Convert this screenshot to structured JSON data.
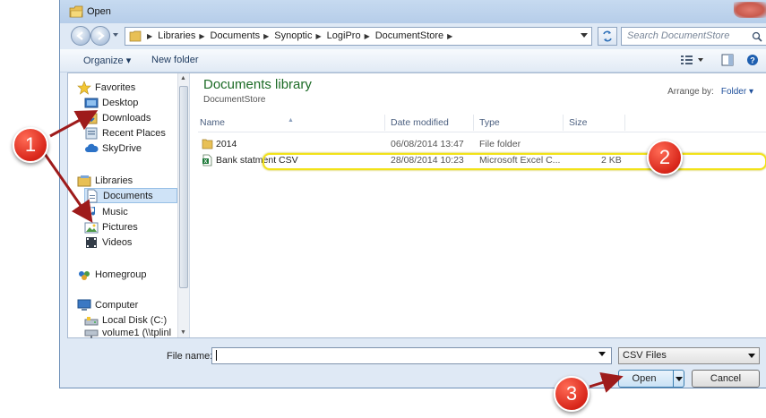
{
  "window": {
    "title": "Open",
    "title_icon": "folder-open-icon",
    "close_icon": "close-icon"
  },
  "address": {
    "crumbs": [
      "Libraries",
      "Documents",
      "Synoptic",
      "LogiPro",
      "DocumentStore"
    ],
    "search_placeholder": "Search DocumentStore"
  },
  "toolbar": {
    "organize_label": "Organize ▾",
    "new_folder_label": "New folder"
  },
  "nav": {
    "favorites": "Favorites",
    "desktop": "Desktop",
    "downloads": "Downloads",
    "recent": "Recent Places",
    "skydrive": "SkyDrive",
    "libraries": "Libraries",
    "documents": "Documents",
    "music": "Music",
    "pictures": "Pictures",
    "videos": "Videos",
    "homegroup": "Homegroup",
    "computer": "Computer",
    "localdisk": "Local Disk (C:)",
    "volume": "volume1 (\\\\tplinl"
  },
  "library": {
    "title": "Documents library",
    "subtitle": "DocumentStore",
    "arrange_label": "Arrange by:",
    "arrange_value": "Folder ▾"
  },
  "columns": {
    "name": "Name",
    "date": "Date modified",
    "type": "Type",
    "size": "Size"
  },
  "files": [
    {
      "name": "2014",
      "date": "06/08/2014 13:47",
      "type": "File folder",
      "size": ""
    },
    {
      "name": "Bank statment CSV",
      "date": "28/08/2014 10:23",
      "type": "Microsoft Excel C...",
      "size": "2 KB"
    }
  ],
  "footer": {
    "filename_label": "File name:",
    "filename_value": "",
    "filter": "CSV Files",
    "open_label": "Open",
    "cancel_label": "Cancel"
  },
  "callouts": [
    "1",
    "2",
    "3"
  ],
  "colors": {
    "callout_red": "#d8261a",
    "highlight_yellow": "#f2e218",
    "arrow_red": "#9e1b1b",
    "library_green": "#1c6b26"
  }
}
